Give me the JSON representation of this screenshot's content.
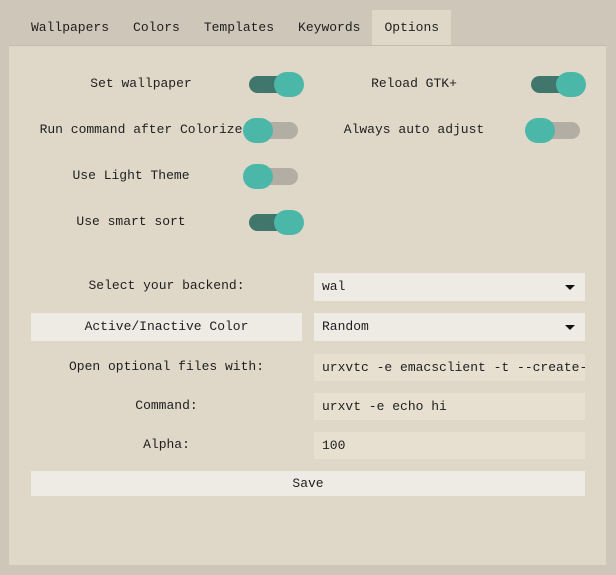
{
  "tabs": [
    {
      "label": "Wallpapers"
    },
    {
      "label": "Colors"
    },
    {
      "label": "Templates"
    },
    {
      "label": "Keywords"
    },
    {
      "label": "Options",
      "active": true
    }
  ],
  "switches": {
    "set_wallpaper": {
      "label": "Set wallpaper",
      "on": true
    },
    "reload_gtk": {
      "label": "Reload GTK+",
      "on": true
    },
    "run_command": {
      "label": "Run command after Colorize",
      "on": false
    },
    "auto_adjust": {
      "label": "Always auto adjust",
      "on": false
    },
    "light_theme": {
      "label": "Use Light Theme",
      "on": false
    },
    "smart_sort": {
      "label": "Use smart sort",
      "on": true
    }
  },
  "backend": {
    "label": "Select your backend:",
    "value": "wal"
  },
  "active_color": {
    "button_label": "Active/Inactive Color",
    "value": "Random"
  },
  "open_files": {
    "label": "Open optional files with:",
    "value": "urxvtc -e emacsclient -t --create-frame"
  },
  "command": {
    "label": "Command:",
    "value": "urxvt -e echo hi"
  },
  "alpha": {
    "label": "Alpha:",
    "value": "100"
  },
  "save_label": "Save",
  "colors": {
    "accent": "#4bb7a8",
    "track_on": "#40766c",
    "track_off": "#b3aea3",
    "panel": "#dfd8c9"
  }
}
